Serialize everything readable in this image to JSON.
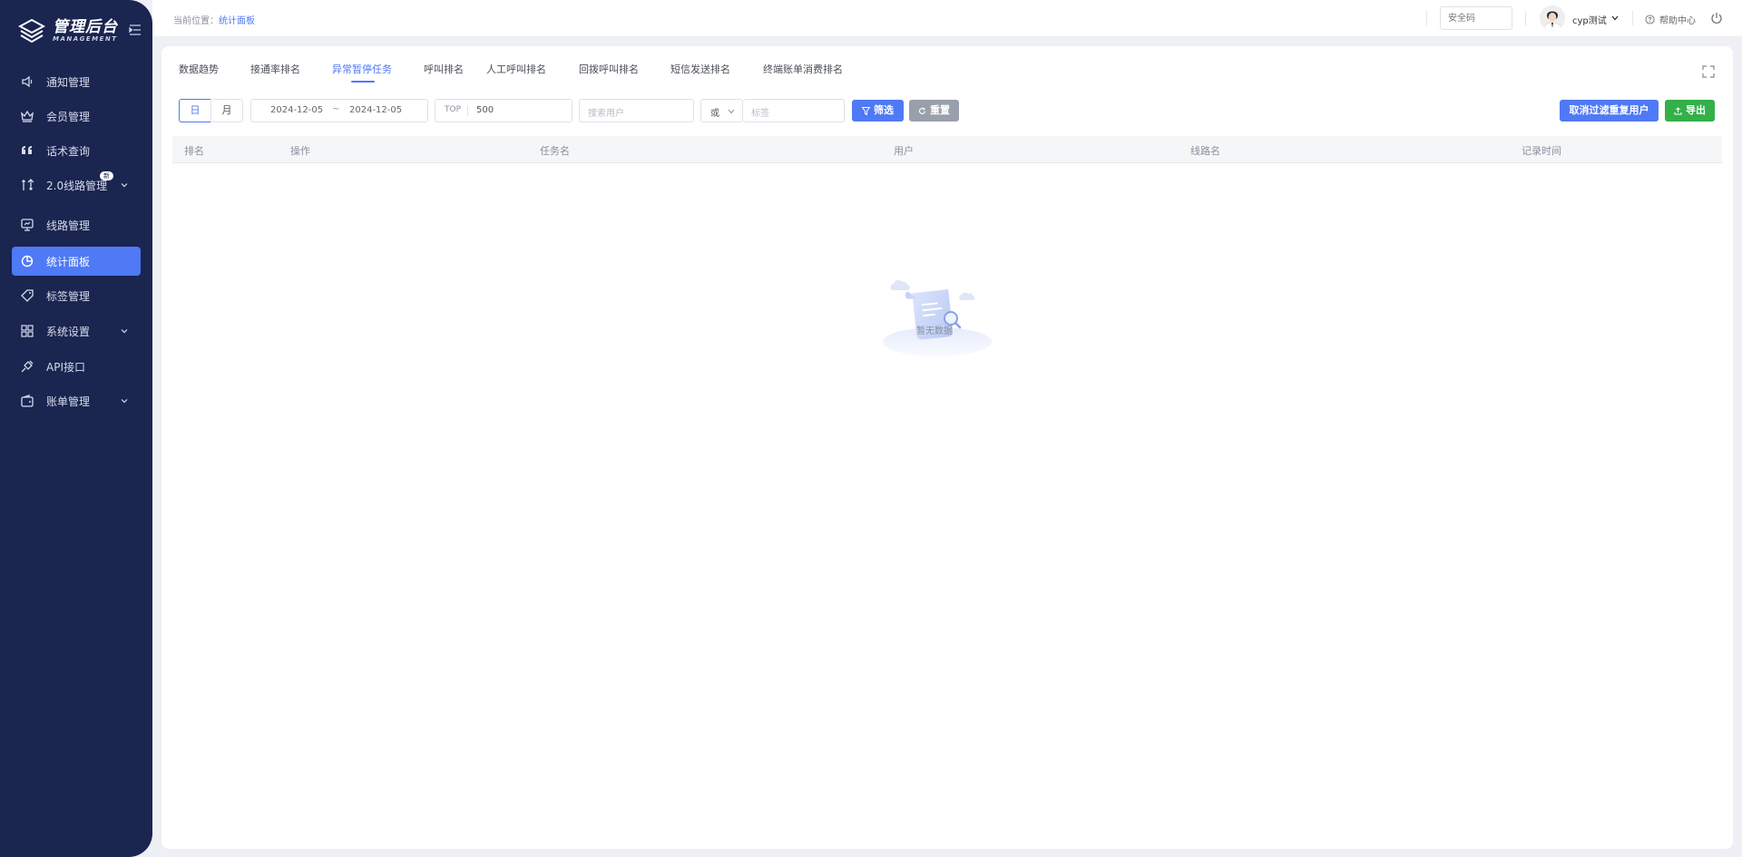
{
  "logo": {
    "title": "管理后台",
    "subtitle": "MANAGEMENT"
  },
  "sidebar": {
    "items": [
      {
        "label": "通知管理",
        "icon": "speaker-icon"
      },
      {
        "label": "会员管理",
        "icon": "crown-icon"
      },
      {
        "label": "话术查询",
        "icon": "quote-icon"
      },
      {
        "label": "2.0线路管理",
        "icon": "route-icon",
        "badge": "新"
      },
      {
        "label": "线路管理",
        "icon": "monitor-icon"
      },
      {
        "label": "统计面板",
        "icon": "pie-chart-icon"
      },
      {
        "label": "标签管理",
        "icon": "tag-icon"
      },
      {
        "label": "系统设置",
        "icon": "grid-icon"
      },
      {
        "label": "API接口",
        "icon": "plug-icon"
      },
      {
        "label": "账单管理",
        "icon": "wallet-icon"
      }
    ]
  },
  "header": {
    "breadcrumb_prefix": "当前位置：",
    "breadcrumb_current": "统计面板",
    "security_placeholder": "安全码",
    "username": "cyp测试",
    "help_label": "帮助中心"
  },
  "tabs": [
    {
      "label": "数据趋势"
    },
    {
      "label": "接通率排名"
    },
    {
      "label": "异常暂停任务"
    },
    {
      "label": "呼叫排名"
    },
    {
      "label": "人工呼叫排名"
    },
    {
      "label": "回拨呼叫排名"
    },
    {
      "label": "短信发送排名"
    },
    {
      "label": "终端账单消费排名"
    }
  ],
  "filters": {
    "day_label": "日",
    "month_label": "月",
    "date_start": "2024-12-05",
    "date_sep": "~",
    "date_end": "2024-12-05",
    "top_label": "TOP",
    "top_value": "500",
    "user_placeholder": "搜索用户",
    "logic_value": "或",
    "tag_placeholder": "标签",
    "filter_button": "筛选",
    "reset_button": "重置",
    "cancel_dup_button": "取消过滤重复用户",
    "export_button": "导出"
  },
  "colors": {
    "primary": "#4f79f5",
    "sidebar": "#1a2550",
    "success": "#33b04a",
    "muted": "#9aa0ab"
  },
  "table": {
    "columns": [
      "排名",
      "操作",
      "任务名",
      "用户",
      "线路名",
      "记录时间"
    ]
  },
  "empty": {
    "text": "暂无数据"
  }
}
